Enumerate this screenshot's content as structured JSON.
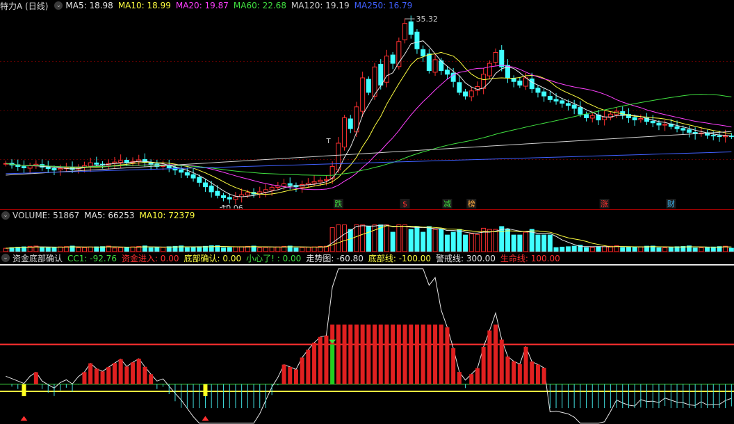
{
  "stock": {
    "title": "特力A (日线)"
  },
  "main_legend": [
    {
      "label": "MA5: 18.98",
      "color": "#e6e6e6"
    },
    {
      "label": "MA10: 18.99",
      "color": "#ffff40"
    },
    {
      "label": "MA20: 19.87",
      "color": "#ff40ff"
    },
    {
      "label": "MA60: 22.68",
      "color": "#40e040"
    },
    {
      "label": "MA120: 19.19",
      "color": "#d0d0d0"
    },
    {
      "label": "MA250: 16.79",
      "color": "#4060ff"
    }
  ],
  "volume_legend": [
    {
      "label": "VOLUME: 51867",
      "color": "#d8d8d8"
    },
    {
      "label": "MA5: 66253",
      "color": "#e6e6e6"
    },
    {
      "label": "MA10: 72379",
      "color": "#ffff40"
    }
  ],
  "indicator_legend": [
    {
      "label": "资金底部确认",
      "color": "#d8d8d8"
    },
    {
      "label": "CC1: -92.76",
      "color": "#40e040"
    },
    {
      "label": "资金进入: 0.00",
      "color": "#ff3030"
    },
    {
      "label": "底部确认: 0.00",
      "color": "#ffff40"
    },
    {
      "label": "小心了! : 0.00",
      "color": "#40e040"
    },
    {
      "label": "走势图: -60.80",
      "color": "#e6e6e6"
    },
    {
      "label": "底部线: -100.00",
      "color": "#ffff40"
    },
    {
      "label": "警戒线: 300.00",
      "color": "#e6e6e6"
    },
    {
      "label": "生命线: 100.00",
      "color": "#ff3030"
    }
  ],
  "price_annotations": {
    "high": "35.32",
    "low": "10.06",
    "marker_t": "T"
  },
  "event_tags": [
    {
      "text": "跌",
      "color": "#40e040"
    },
    {
      "text": "$",
      "color": "#ff3030"
    },
    {
      "text": "减",
      "color": "#40e040"
    },
    {
      "text": "榜",
      "color": "#ffaa40"
    },
    {
      "text": "涨",
      "color": "#ff3030"
    },
    {
      "text": "财",
      "color": "#40c0ff"
    }
  ],
  "colors": {
    "up": "#ff3030",
    "down": "#40ffff",
    "background": "#000000",
    "separator": "#a00000"
  },
  "chart_data": {
    "type": "candlestick",
    "price_range": [
      9,
      36
    ],
    "closes": [
      15.2,
      15.0,
      14.8,
      14.6,
      14.9,
      15.1,
      14.7,
      14.5,
      14.3,
      14.5,
      14.6,
      14.4,
      14.7,
      14.9,
      15.3,
      15.1,
      15.0,
      15.2,
      15.4,
      15.6,
      15.3,
      15.5,
      15.7,
      15.4,
      15.1,
      14.8,
      14.9,
      14.6,
      14.3,
      14.0,
      13.6,
      13.2,
      12.6,
      12.0,
      11.3,
      10.8,
      10.5,
      10.3,
      10.6,
      10.9,
      11.2,
      11.0,
      11.3,
      11.6,
      11.9,
      12.1,
      12.4,
      12.2,
      12.0,
      12.3,
      12.5,
      12.7,
      12.9,
      13.0,
      14.8,
      18.0,
      21.5,
      20.0,
      23.0,
      27.0,
      25.0,
      28.5,
      26.0,
      30.0,
      29.0,
      32.0,
      34.5,
      33.0,
      31.0,
      30.0,
      28.0,
      29.5,
      28.0,
      27.5,
      26.5,
      25.0,
      24.5,
      25.2,
      25.8,
      27.5,
      29.0,
      30.5,
      28.5,
      27.0,
      26.5,
      26.0,
      27.0,
      25.5,
      25.0,
      24.5,
      24.0,
      23.8,
      23.5,
      23.2,
      22.8,
      22.0,
      21.5,
      21.8,
      21.2,
      21.6,
      22.0,
      22.4,
      21.9,
      21.5,
      21.2,
      21.4,
      21.0,
      20.8,
      20.5,
      20.6,
      20.3,
      20.0,
      19.8,
      19.5,
      19.3,
      19.4,
      19.1,
      19.0,
      18.9,
      19.0,
      18.98
    ],
    "ma_series": [
      "MA5",
      "MA10",
      "MA20",
      "MA60",
      "MA120",
      "MA250"
    ],
    "volume_range": [
      0,
      200000
    ],
    "indicator_range": [
      -100,
      300
    ],
    "indicator_lines": {
      "警戒线": 300,
      "生命线": 100,
      "底部线": -100
    }
  }
}
